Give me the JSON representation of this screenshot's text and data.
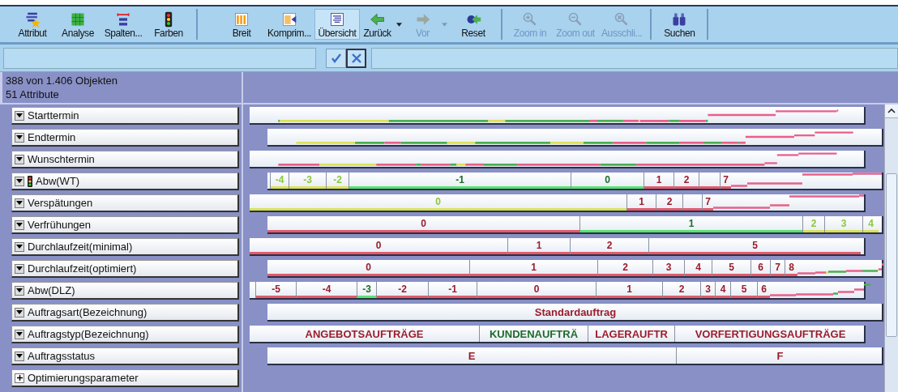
{
  "toolbar": {
    "groups": [
      [
        {
          "label": "Attribut",
          "disabled": false,
          "selected": false,
          "has_menu": false
        },
        {
          "label": "Analyse",
          "disabled": false,
          "selected": false,
          "has_menu": false
        },
        {
          "label": "Spalten...",
          "disabled": false,
          "selected": false,
          "has_menu": false
        },
        {
          "label": "Farben",
          "disabled": false,
          "selected": false,
          "has_menu": false
        }
      ],
      [
        {
          "label": "Breit",
          "disabled": false,
          "selected": false,
          "has_menu": false
        },
        {
          "label": "Komprim...",
          "disabled": false,
          "selected": false,
          "has_menu": false
        },
        {
          "label": "Übersicht",
          "disabled": false,
          "selected": true,
          "has_menu": false
        },
        {
          "label": "Zurück",
          "disabled": false,
          "selected": false,
          "has_menu": true
        },
        {
          "label": "Vor",
          "disabled": true,
          "selected": false,
          "has_menu": true
        },
        {
          "label": "Reset",
          "disabled": false,
          "selected": false,
          "has_menu": false
        }
      ],
      [
        {
          "label": "Zoom in",
          "disabled": true,
          "selected": false,
          "has_menu": false
        },
        {
          "label": "Zoom out",
          "disabled": true,
          "selected": false,
          "has_menu": false
        },
        {
          "label": "Ausschli...",
          "disabled": true,
          "selected": false,
          "has_menu": false
        }
      ],
      [
        {
          "label": "Suchen",
          "disabled": false,
          "selected": false,
          "has_menu": false
        }
      ]
    ]
  },
  "info": {
    "objects": "388 von 1.406 Objekten",
    "attributes": "51 Attribute"
  },
  "attributes": [
    {
      "label": "Starttermin",
      "kind": "attribute",
      "coloring": false,
      "bar": {
        "kind": "timeline"
      }
    },
    {
      "label": "Endtermin",
      "kind": "attribute",
      "coloring": false,
      "bar": {
        "kind": "timeline"
      }
    },
    {
      "label": "Wunschtermin",
      "kind": "attribute",
      "coloring": false,
      "bar": {
        "kind": "timeline"
      }
    },
    {
      "label": "Abw(WT)",
      "kind": "attribute",
      "coloring": true,
      "bar": {
        "kind": "segments",
        "underline": true,
        "segments": [
          {
            "label": "-4",
            "color": "#8cc63f"
          },
          {
            "label": "-3",
            "color": "#8cc63f"
          },
          {
            "label": "-2",
            "color": "#8cc63f"
          },
          {
            "label": "-1",
            "color": "#1d6b2a"
          },
          {
            "label": "0",
            "color": "#1d6b2a"
          },
          {
            "label": "1",
            "color": "#9b1c2c"
          },
          {
            "label": "2",
            "color": "#9b1c2c"
          },
          {
            "label": "7",
            "color": "#9b1c2c"
          }
        ]
      }
    },
    {
      "label": "Verspätungen",
      "kind": "attribute",
      "coloring": false,
      "bar": {
        "kind": "segments",
        "underline": true,
        "segments": [
          {
            "label": "0",
            "color": "#8cc63f"
          },
          {
            "label": "1",
            "color": "#9b1c2c"
          },
          {
            "label": "2",
            "color": "#9b1c2c"
          },
          {
            "label": "7",
            "color": "#9b1c2c"
          }
        ]
      }
    },
    {
      "label": "Verfrühungen",
      "kind": "attribute",
      "coloring": false,
      "bar": {
        "kind": "segments",
        "underline": true,
        "segments": [
          {
            "label": "0",
            "color": "#9b1c2c"
          },
          {
            "label": "1",
            "color": "#1d6b2a"
          },
          {
            "label": "2",
            "color": "#8cc63f"
          },
          {
            "label": "3",
            "color": "#8cc63f"
          },
          {
            "label": "4",
            "color": "#8cc63f"
          }
        ]
      }
    },
    {
      "label": "Durchlaufzeit(minimal)",
      "kind": "attribute",
      "coloring": false,
      "bar": {
        "kind": "segments",
        "underline": true,
        "segments": [
          {
            "label": "0",
            "color": "#9b1c2c"
          },
          {
            "label": "1",
            "color": "#9b1c2c"
          },
          {
            "label": "2",
            "color": "#9b1c2c"
          },
          {
            "label": "5",
            "color": "#9b1c2c"
          }
        ]
      }
    },
    {
      "label": "Durchlaufzeit(optimiert)",
      "kind": "attribute",
      "coloring": false,
      "bar": {
        "kind": "segments",
        "underline": true,
        "segments": [
          {
            "label": "0",
            "color": "#9b1c2c"
          },
          {
            "label": "1",
            "color": "#9b1c2c"
          },
          {
            "label": "2",
            "color": "#9b1c2c"
          },
          {
            "label": "3",
            "color": "#9b1c2c"
          },
          {
            "label": "4",
            "color": "#9b1c2c"
          },
          {
            "label": "5",
            "color": "#9b1c2c"
          },
          {
            "label": "6",
            "color": "#9b1c2c"
          },
          {
            "label": "7",
            "color": "#9b1c2c"
          },
          {
            "label": "8",
            "color": "#9b1c2c"
          }
        ]
      }
    },
    {
      "label": "Abw(DLZ)",
      "kind": "attribute",
      "coloring": false,
      "bar": {
        "kind": "segments",
        "underline": true,
        "segments": [
          {
            "label": "-5",
            "color": "#9b1c2c"
          },
          {
            "label": "-4",
            "color": "#9b1c2c"
          },
          {
            "label": "-3",
            "color": "#1d6b2a"
          },
          {
            "label": "-2",
            "color": "#9b1c2c"
          },
          {
            "label": "-1",
            "color": "#9b1c2c"
          },
          {
            "label": "0",
            "color": "#9b1c2c"
          },
          {
            "label": "1",
            "color": "#9b1c2c"
          },
          {
            "label": "2",
            "color": "#9b1c2c"
          },
          {
            "label": "3",
            "color": "#9b1c2c"
          },
          {
            "label": "4",
            "color": "#9b1c2c"
          },
          {
            "label": "5",
            "color": "#9b1c2c"
          },
          {
            "label": "6",
            "color": "#9b1c2c"
          }
        ]
      }
    },
    {
      "label": "Auftragsart(Bezeichnung)",
      "kind": "attribute",
      "coloring": false,
      "bar": {
        "kind": "segments",
        "underline": false,
        "segments": [
          {
            "label": "Standardauftrag",
            "color": "#9b1c2c"
          }
        ]
      }
    },
    {
      "label": "Auftragstyp(Bezeichnung)",
      "kind": "attribute",
      "coloring": false,
      "bar": {
        "kind": "segments",
        "underline": false,
        "segments": [
          {
            "label": "ANGEBOTSAUFTRÄGE",
            "color": "#9b1c2c"
          },
          {
            "label": "KUNDENAUFTRÄ",
            "color": "#1d6b2a"
          },
          {
            "label": "LAGERAUFTR",
            "color": "#9b1c2c"
          },
          {
            "label": "VORFERTIGUNGSAUFTRÄGE",
            "color": "#9b1c2c"
          }
        ]
      }
    },
    {
      "label": "Auftragsstatus",
      "kind": "attribute",
      "coloring": false,
      "bar": {
        "kind": "segments",
        "underline": false,
        "segments": [
          {
            "label": "E",
            "color": "#9b1c2c"
          },
          {
            "label": "F",
            "color": "#9b1c2c"
          }
        ]
      }
    },
    {
      "label": "Optimierungsparameter",
      "kind": "group",
      "expanded": false
    }
  ]
}
